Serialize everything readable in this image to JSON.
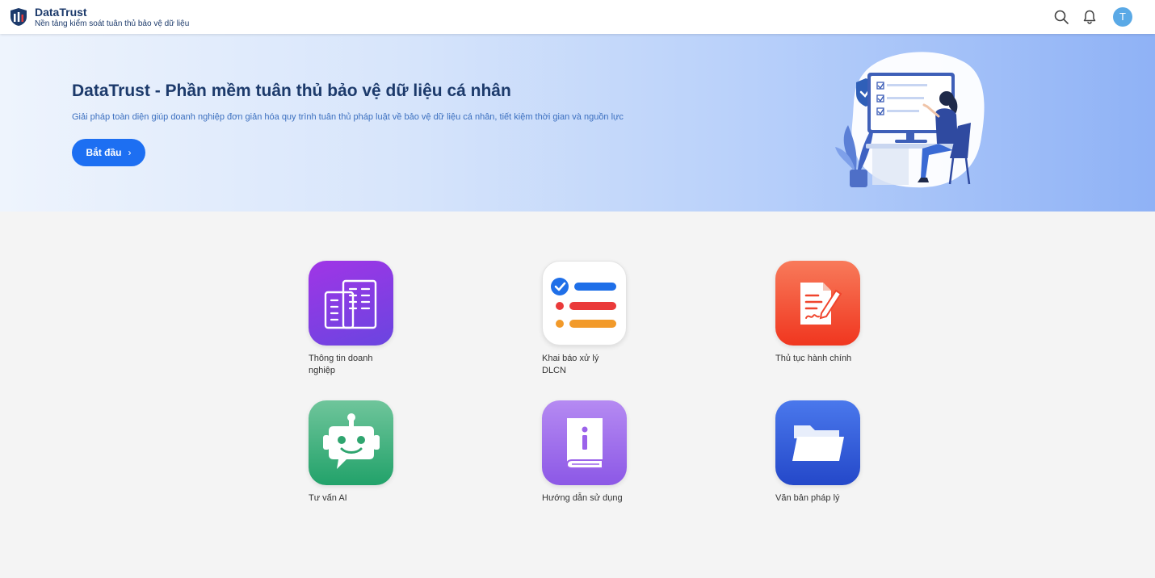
{
  "header": {
    "brand_title": "DataTrust",
    "brand_subtitle": "Nền tảng kiểm soát tuân thủ bảo vệ dữ liệu",
    "icons": [
      "search-icon",
      "bell-icon"
    ],
    "avatar_initial": "T"
  },
  "hero": {
    "title": "DataTrust - Phần mềm tuân thủ bảo vệ dữ liệu cá nhân",
    "description": "Giải pháp toàn diện giúp doanh nghiệp đơn giản hóa quy trình tuân thủ pháp luật về bảo vệ dữ liệu cá nhân, tiết kiệm thời gian và nguồn lực",
    "cta_label": "Bắt đầu",
    "cta_icon": "chevron-right-icon"
  },
  "tiles": [
    {
      "label": "Thông tin doanh nghiệp",
      "icon": "building-icon",
      "color": "#7b3fe4"
    },
    {
      "label": "Khai báo xử lý DLCN",
      "icon": "checklist-icon",
      "color": "#ffffff"
    },
    {
      "label": "Thủ tục hành chính",
      "icon": "document-edit-icon",
      "color": "#f2452e"
    },
    {
      "label": "Tư vấn AI",
      "icon": "robot-icon",
      "color": "#2fa56f"
    },
    {
      "label": "Hướng dẫn sử dụng",
      "icon": "book-info-icon",
      "color": "#9b62ea"
    },
    {
      "label": "Văn bản pháp lý",
      "icon": "folder-icon",
      "color": "#2f5fd9"
    }
  ],
  "colors": {
    "brand": "#1c3a6b",
    "accent": "#1d6ff2",
    "page_bg": "#f4f4f4"
  }
}
